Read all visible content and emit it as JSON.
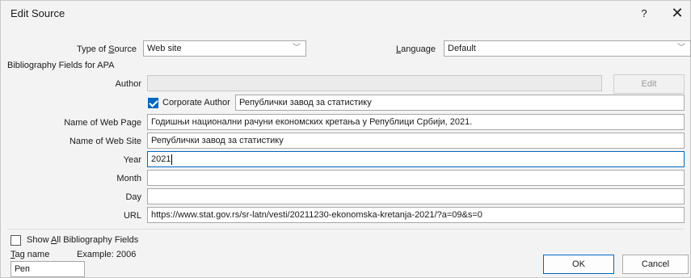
{
  "dialog": {
    "title": "Edit Source",
    "help_label": "?",
    "close_label": "✕"
  },
  "source": {
    "type_label_pre": "Type of ",
    "type_label_acc": "S",
    "type_label_post": "ource",
    "type_value": "Web site",
    "language_label_acc": "L",
    "language_label_post": "anguage",
    "language_value": "Default"
  },
  "group": {
    "label": "Bibliography Fields for APA"
  },
  "fields": {
    "author_label": "Author",
    "author_value": "",
    "edit_label": "Edit",
    "corporate_author_label": "Corporate Author",
    "corporate_author_checked": true,
    "corporate_author_value": "Републички завод за статистику",
    "web_page_label": "Name of Web Page",
    "web_page_value": "Годишњи национални рачуни економских кретања у Републици Србији, 2021.",
    "web_site_label": "Name of Web Site",
    "web_site_value": "Републички завод за статистику",
    "year_label": "Year",
    "year_value": "2021",
    "month_label": "Month",
    "month_value": "",
    "day_label": "Day",
    "day_value": "",
    "url_label": "URL",
    "url_value": "https://www.stat.gov.rs/sr-latn/vesti/20211230-ekonomska-kretanja-2021/?a=09&s=0"
  },
  "footer": {
    "show_all_pre": "Show ",
    "show_all_acc": "A",
    "show_all_post": "ll Bibliography Fields",
    "show_all_checked": false,
    "tag_label_acc": "T",
    "tag_label_post": "ag name",
    "example_label": "Example: 2006",
    "tag_value": "Реп",
    "ok_label": "OK",
    "cancel_label": "Cancel"
  },
  "colors": {
    "accent": "#0067c0",
    "background": "#f3f3f3"
  },
  "icons": {
    "dropdown": "chevron-down-icon",
    "close": "close-icon",
    "help": "help-icon",
    "check": "check-icon"
  }
}
